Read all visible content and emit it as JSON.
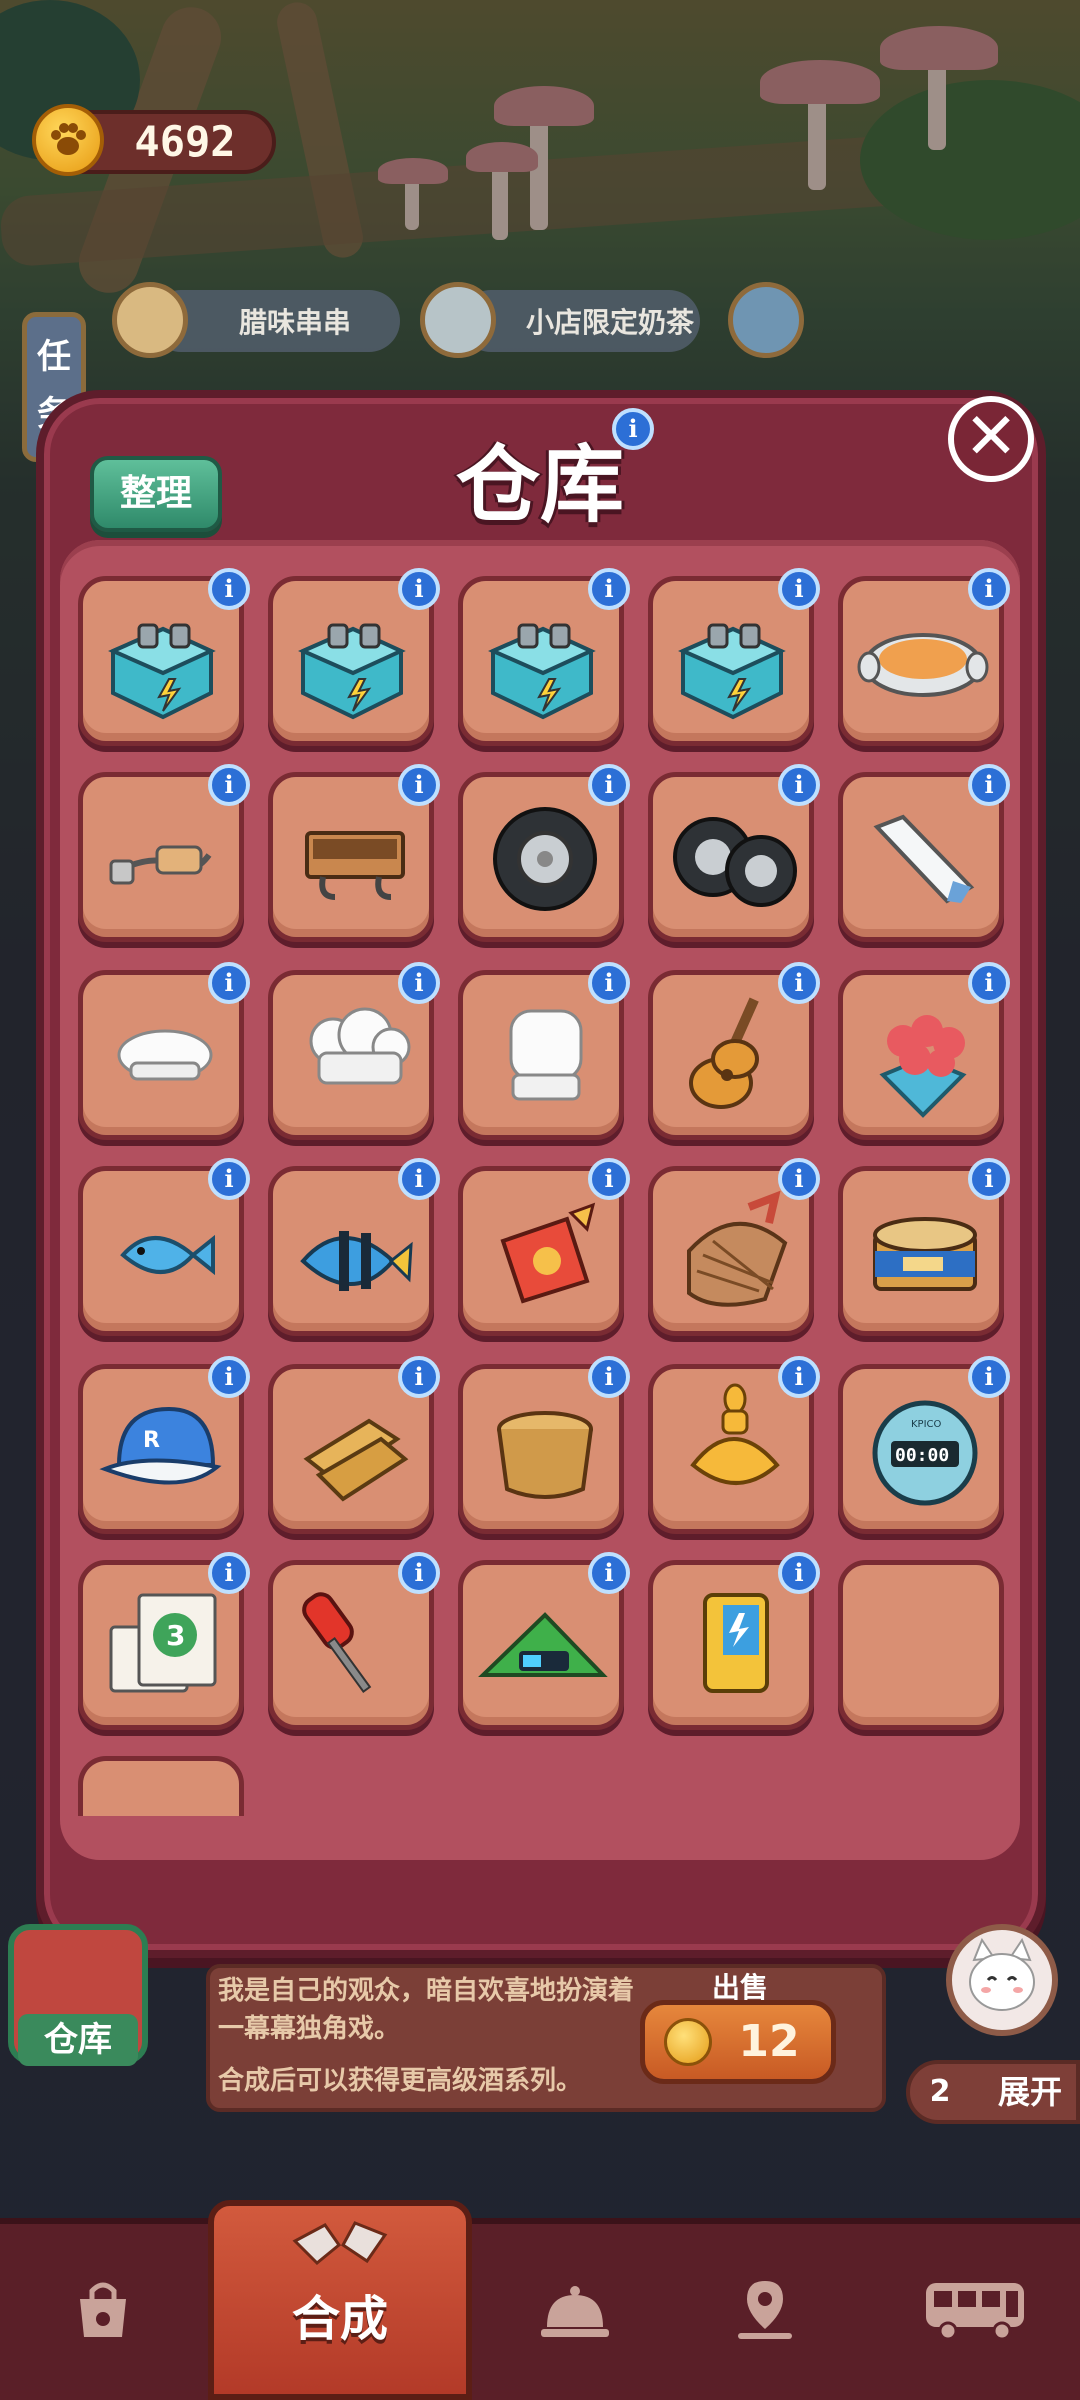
{
  "header": {
    "coin_icon": "paw-coin-icon",
    "coin_value": "4692",
    "task_tab": [
      "任",
      "务"
    ],
    "orders": [
      {
        "label": "腊味串串",
        "icon": "food-plate-icon"
      },
      {
        "label": "小店限定奶茶",
        "icon": "milk-tea-icon"
      },
      {
        "icon": "customer-avatar-icon"
      }
    ]
  },
  "dialog": {
    "title": "仓库",
    "tidy_label": "整理",
    "close_icon": "close-icon",
    "info_symbol": "i"
  },
  "grid": {
    "rows": [
      [
        "battery-box-icon",
        "battery-box-icon",
        "battery-box-icon",
        "battery-box-icon",
        "soup-bowl-icon"
      ],
      [
        "wire-plug-icon",
        "wall-shelf-icon",
        "tire-icon",
        "tire-pair-icon",
        "paper-strip-icon"
      ],
      [
        "chef-hat-small-icon",
        "chef-hat-medium-icon",
        "chef-hat-tall-icon",
        "guitar-icon",
        "rose-bouquet-icon"
      ],
      [
        "small-fish-icon",
        "angelfish-icon",
        "red-pouch-icon",
        "woven-basket-icon",
        "tin-can-icon"
      ],
      [
        "baseball-cap-icon",
        "wooden-planks-icon",
        "wooden-bucket-icon",
        "golden-lamp-icon",
        "stopwatch-icon"
      ],
      [
        "calendar-icon",
        "screwdriver-icon",
        "green-battery-icon",
        "yellow-battery-pack-icon",
        "empty-slot"
      ]
    ],
    "cap_letter": "R",
    "calendar_text": "3",
    "stopwatch_text": "00:00",
    "stopwatch_brand": "KPICO"
  },
  "detail": {
    "side_label": "仓库",
    "description": "我是自己的观众，暗自欢喜地扮演着一幕幕独角戏。",
    "tip": "合成后可以获得更高级酒系列。",
    "sell_label": "出售",
    "sell_value": "12",
    "expand_count": "2",
    "expand_label": "展开"
  },
  "nav": {
    "items": [
      {
        "icon": "shop-bag-icon"
      },
      {
        "icon": "merge-hands-icon",
        "label": "合成",
        "active": true
      },
      {
        "icon": "service-bell-icon"
      },
      {
        "icon": "map-pin-icon"
      },
      {
        "icon": "bus-icon"
      }
    ]
  },
  "colors": {
    "dialog_bg": "#7f2a3c",
    "slot_bg": "#d98f73",
    "info_blue": "#2c6fd6",
    "tidy_green": "#3fa47e",
    "nav_active": "#c54a32"
  }
}
